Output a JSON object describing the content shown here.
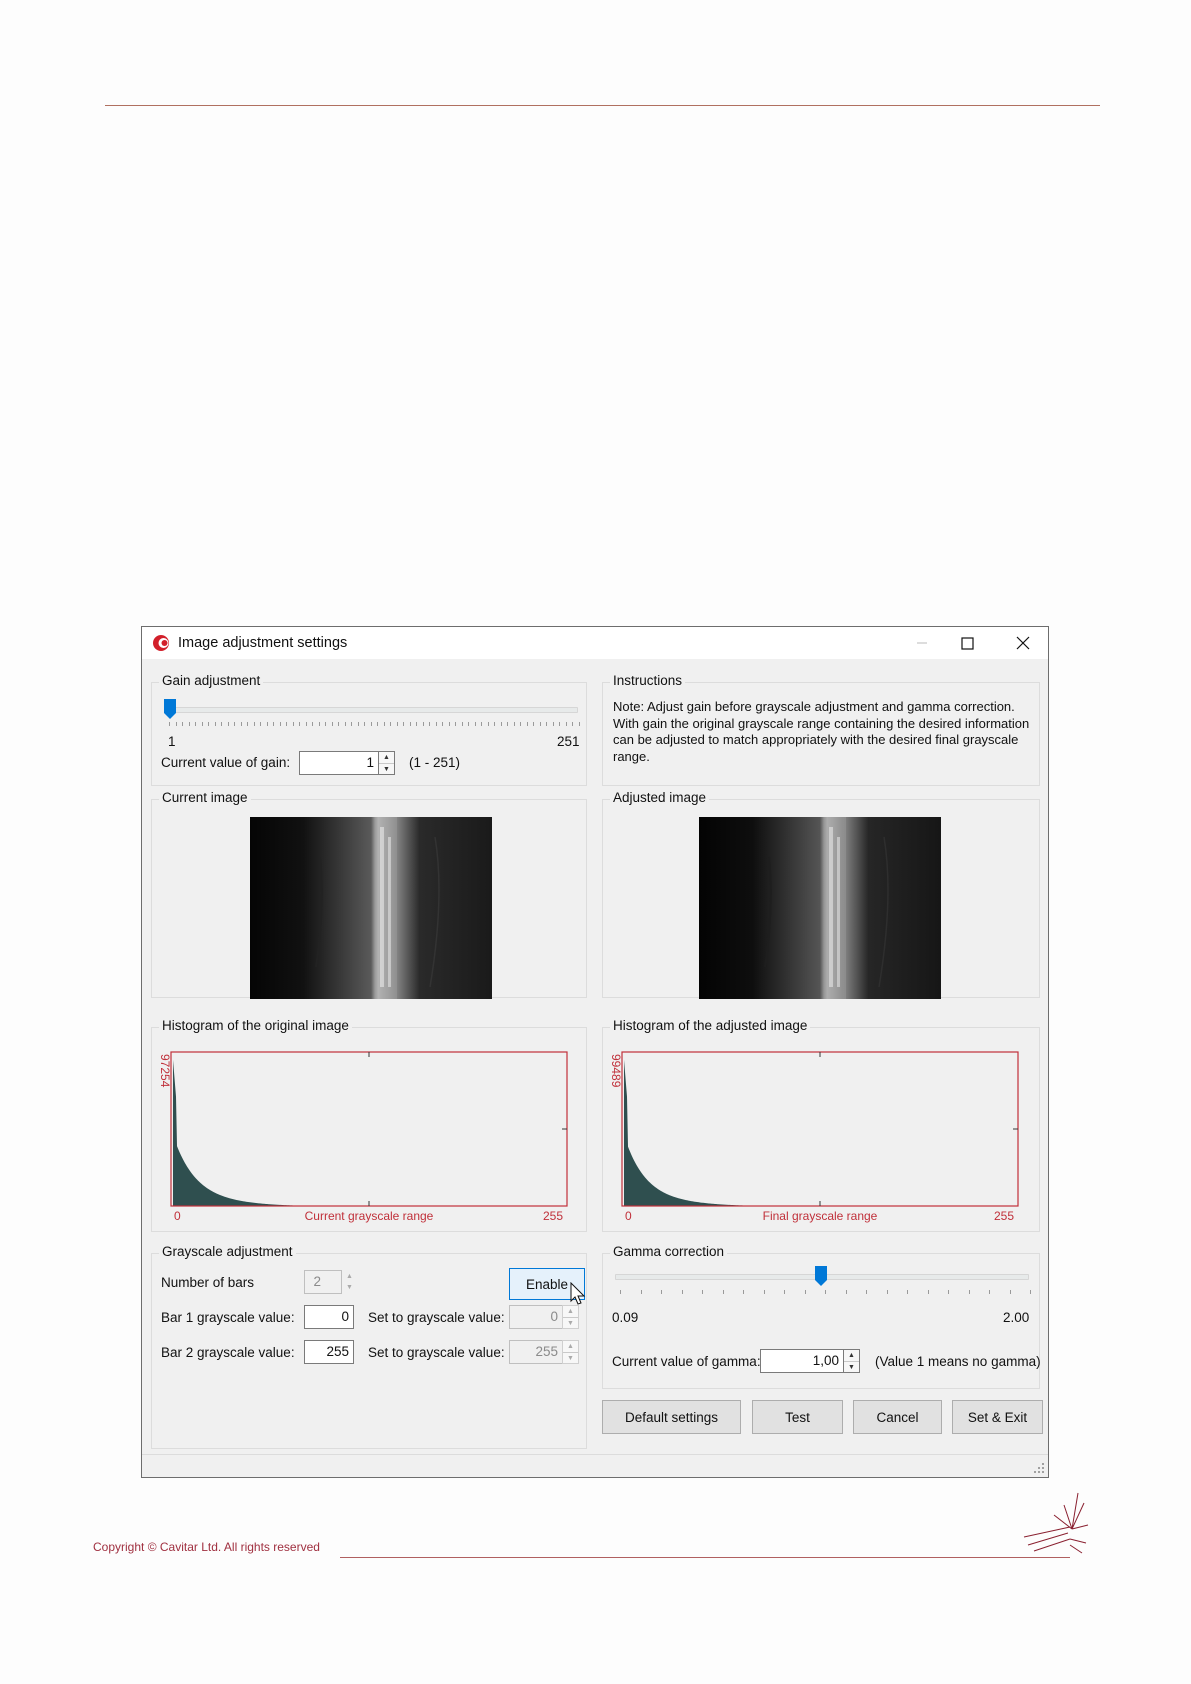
{
  "document": {
    "footer_text": "Copyright © Cavitar Ltd. All rights reserved"
  },
  "window": {
    "title": "Image adjustment settings",
    "controls": {
      "minimize": "—",
      "maximize": "☐",
      "close": "✕"
    }
  },
  "gain": {
    "group_label": "Gain adjustment",
    "slider_min_label": "1",
    "slider_max_label": "251",
    "slider_level": 0.0,
    "value_label": "Current value of gain:",
    "value": "1",
    "range_hint": "(1 - 251)"
  },
  "instructions": {
    "group_label": "Instructions",
    "text_lines": [
      "Note: Adjust gain before grayscale adjustment and gamma correction.",
      "With gain the original grayscale range containing the desired information",
      "can be adjusted to match appropriately with the desired final grayscale",
      "range."
    ]
  },
  "current_image": {
    "group_label": "Current image"
  },
  "adjusted_image": {
    "group_label": "Adjusted image"
  },
  "hist_original": {
    "group_label": "Histogram of the original image",
    "y_max_label": "97254",
    "x_min_label": "0",
    "x_max_label": "255",
    "x_title": "Current grayscale range"
  },
  "hist_adjusted": {
    "group_label": "Histogram of the adjusted image",
    "y_max_label": "99489",
    "x_min_label": "0",
    "x_max_label": "255",
    "x_title": "Final grayscale range"
  },
  "grayscale": {
    "group_label": "Grayscale adjustment",
    "bars_label": "Number of bars",
    "bars_value": "2",
    "enable_button": "Enable",
    "bar1_label": "Bar 1 grayscale value:",
    "bar1_value": "0",
    "bar1_set_label": "Set to grayscale value:",
    "bar1_set_value": "0",
    "bar2_label": "Bar 2 grayscale value:",
    "bar2_value": "255",
    "bar2_set_label": "Set to grayscale value:",
    "bar2_set_value": "255"
  },
  "gamma": {
    "group_label": "Gamma correction",
    "slider_min_label": "0.09",
    "slider_max_label": "2.00",
    "slider_level": 0.5,
    "value_label": "Current value of gamma:",
    "value": "1,00",
    "hint": "(Value 1 means no gamma)"
  },
  "buttons": {
    "default": "Default settings",
    "test": "Test",
    "cancel": "Cancel",
    "set_exit": "Set & Exit"
  },
  "colors": {
    "histogram_frame": "#c0303a",
    "histogram_fill": "#2f4f4f",
    "accent_blue": "#0078d7"
  }
}
